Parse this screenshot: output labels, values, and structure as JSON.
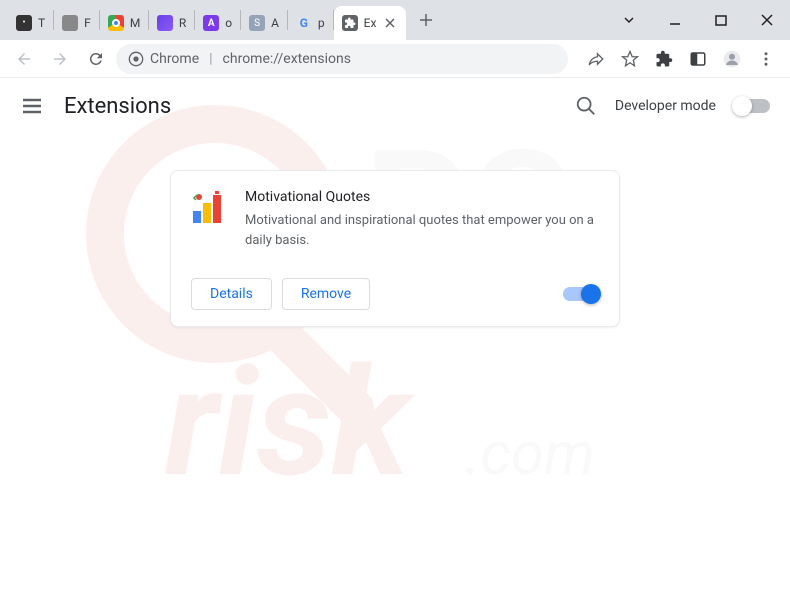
{
  "window": {
    "title": "Extensions"
  },
  "tabs": [
    {
      "label": "T",
      "favicon": "dark"
    },
    {
      "label": "F",
      "favicon": "globe"
    },
    {
      "label": "M",
      "favicon": "chrome"
    },
    {
      "label": "R",
      "favicon": "purple"
    },
    {
      "label": "o",
      "favicon": "a-purple"
    },
    {
      "label": "A",
      "favicon": "s-gray"
    },
    {
      "label": "p",
      "favicon": "google"
    },
    {
      "label": "Ex",
      "favicon": "ext",
      "active": true
    }
  ],
  "omnibox": {
    "secure_label": "Chrome",
    "url": "chrome://extensions"
  },
  "page": {
    "title": "Extensions",
    "developer_mode_label": "Developer mode",
    "developer_mode_on": false
  },
  "extension_card": {
    "name": "Motivational Quotes",
    "description": "Motivational and inspirational quotes that empower you on a daily basis.",
    "details_label": "Details",
    "remove_label": "Remove",
    "enabled": true
  },
  "icons": {
    "menu": "menu-icon",
    "search": "search-icon",
    "back": "back-icon",
    "forward": "forward-icon",
    "reload": "reload-icon",
    "share": "share-icon",
    "star": "star-icon",
    "puzzle": "extensions-icon",
    "panel": "side-panel-icon",
    "profile": "profile-icon",
    "kebab": "kebab-icon",
    "caret": "caret-down-icon",
    "minimize": "minimize-icon",
    "maximize": "maximize-icon",
    "close": "close-icon",
    "plus": "plus-icon"
  },
  "watermark": {
    "text": "pcrisk.com"
  }
}
